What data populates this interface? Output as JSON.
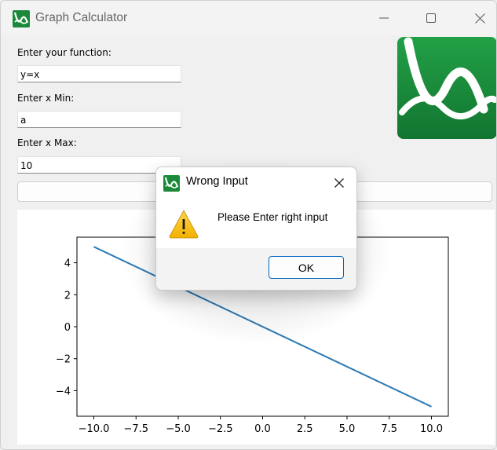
{
  "window": {
    "title": "Graph Calculator",
    "app_icon": "graph-calculator-logo-icon",
    "controls": [
      "minimize-icon",
      "maximize-icon",
      "close-icon"
    ]
  },
  "form": {
    "function_label": "Enter your function:",
    "function_value": "y=x",
    "xmin_label": "Enter x Min:",
    "xmin_value": "a",
    "xmax_label": "Enter x Max:",
    "xmax_value": "10",
    "plot_button_label": ""
  },
  "logo": {
    "icon": "graph-calculator-logo-icon",
    "color": "#1a8a3a"
  },
  "chart_data": {
    "type": "line",
    "series": [
      {
        "x": [
          -10,
          10
        ],
        "y": [
          5,
          -5
        ],
        "color": "#2d7ab5"
      }
    ],
    "xlim": [
      -11,
      11
    ],
    "ylim": [
      -5.6,
      5.6
    ],
    "xticks": [
      -10,
      -7.5,
      -5,
      -2.5,
      0,
      2.5,
      5,
      7.5,
      10
    ],
    "xtick_labels": [
      "−10.0",
      "−7.5",
      "−5.0",
      "−2.5",
      "0.0",
      "2.5",
      "5.0",
      "7.5",
      "10.0"
    ],
    "yticks": [
      -4,
      -2,
      0,
      2,
      4
    ],
    "ytick_labels": [
      "−4",
      "−2",
      "0",
      "2",
      "4"
    ],
    "grid": false
  },
  "dialog": {
    "title": "Wrong Input",
    "message": "Please Enter right input",
    "ok_label": "OK",
    "icon": "warning-icon",
    "close_icon": "close-icon"
  }
}
